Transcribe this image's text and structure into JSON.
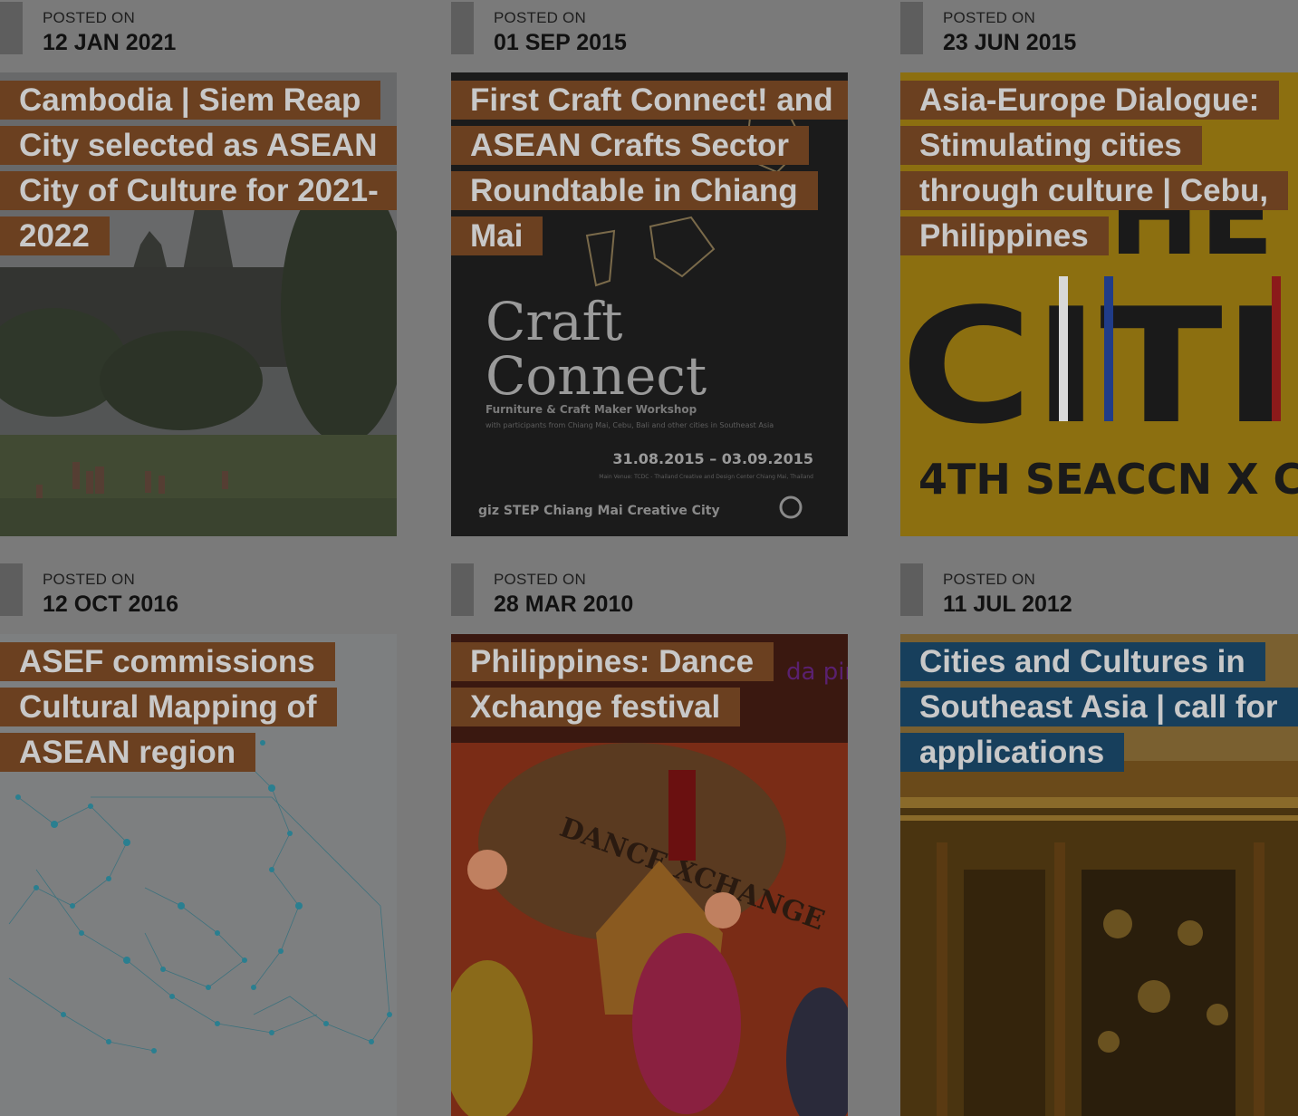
{
  "posts": [
    {
      "posted_label": "POSTED ON",
      "date": "12 JAN 2021",
      "title": "Cambodia | Siem Reap City selected as ASEAN City of Culture for 2021-2022",
      "title_color": "#6b4020"
    },
    {
      "posted_label": "POSTED ON",
      "date": "01 SEP 2015",
      "title": "First Craft Connect! and ASEAN Crafts Sector Roundtable in Chiang Mai",
      "title_color": "#6b4020",
      "image_text": {
        "heading1": "Craft",
        "heading2": "Connect",
        "subheading": "Furniture & Craft Maker Workshop",
        "note": "with participants from Chiang Mai, Cebu, Bali and other cities in Southeast Asia",
        "dates": "31.08.2015 – 03.09.2015",
        "venue": "Main Venue: TCDC - Thailand Creative and Design Center Chiang Mai, Thailand",
        "logos": "giz   STEP   Chiang Mai Creative City"
      }
    },
    {
      "posted_label": "POSTED ON",
      "date": "23 JUN 2015",
      "title": "Asia-Europe Dialogue: Stimulating cities through culture | Cebu, Philippines",
      "title_color": "#6b4020",
      "image_text": {
        "big": "CITI",
        "top": "HE",
        "bottom": "4TH SEACCN X C"
      }
    },
    {
      "posted_label": "POSTED ON",
      "date": "12 OCT 2016",
      "title": "ASEF commissions Cultural Mapping of ASEAN region",
      "title_color": "#6b4020"
    },
    {
      "posted_label": "POSTED ON",
      "date": "28 MAR 2010",
      "title": "Philippines: Dance Xchange festival",
      "title_color": "#6b4020",
      "image_text": {
        "corner": "da pin",
        "banner": "DANCE XCHANGE"
      }
    },
    {
      "posted_label": "POSTED ON",
      "date": "11 JUL 2012",
      "title": "Cities and Cultures in Southeast Asia | call for applications",
      "title_color": "#173f5c"
    }
  ]
}
